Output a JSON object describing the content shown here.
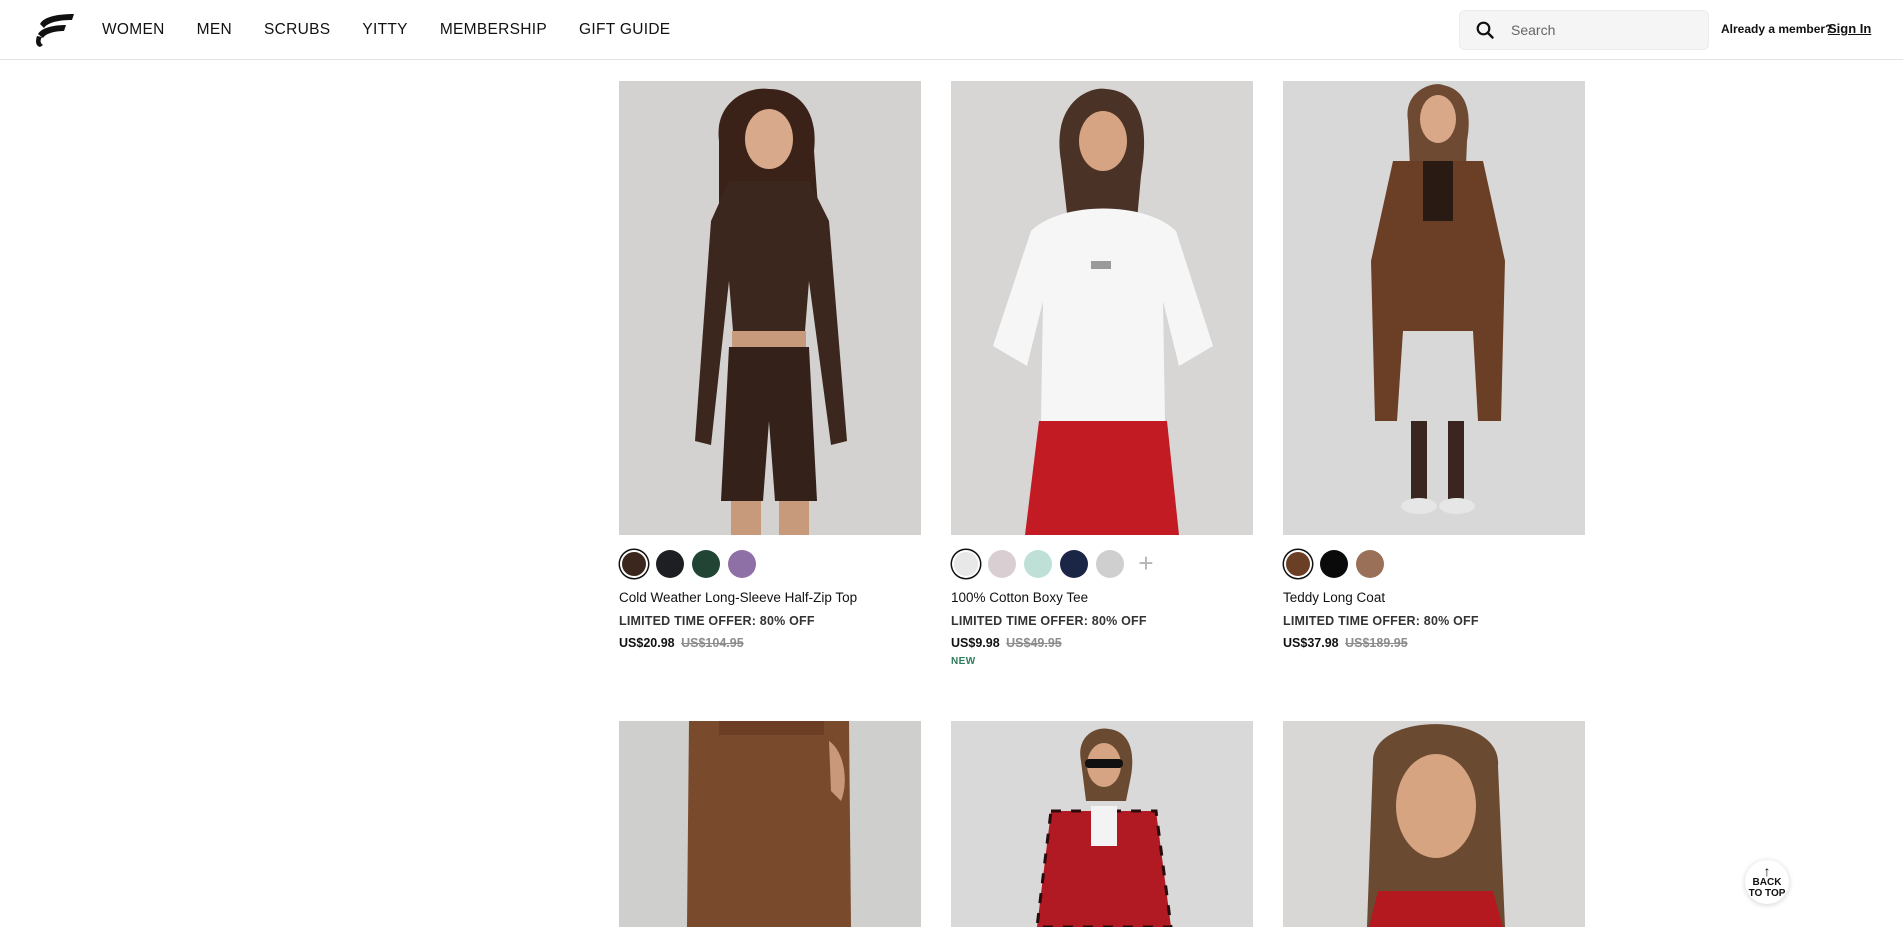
{
  "header": {
    "nav": [
      "WOMEN",
      "MEN",
      "SCRUBS",
      "YITTY",
      "MEMBERSHIP",
      "GIFT GUIDE"
    ],
    "search_placeholder": "Search",
    "member_prompt": "Already a member?",
    "sign_in": "Sign In"
  },
  "products": [
    {
      "name": "Cold Weather Long-Sleeve Half-Zip Top",
      "offer": "LIMITED TIME OFFER: 80% OFF",
      "price": "US$20.98",
      "original_price": "US$104.95",
      "badge": "",
      "swatches": [
        "#3b271d",
        "#1e1f22",
        "#214435",
        "#8e6fa6"
      ]
    },
    {
      "name": "100% Cotton Boxy Tee",
      "offer": "LIMITED TIME OFFER: 80% OFF",
      "price": "US$9.98",
      "original_price": "US$49.95",
      "badge": "NEW",
      "swatches": [
        "#e8e8e8",
        "#d9cfd3",
        "#bfe0d6",
        "#1b2546",
        "#cfcfcf"
      ]
    },
    {
      "name": "Teddy Long Coat",
      "offer": "LIMITED TIME OFFER: 80% OFF",
      "price": "US$37.98",
      "original_price": "US$189.95",
      "badge": "",
      "swatches": [
        "#6b3e26",
        "#0a0a0a",
        "#9a7158"
      ]
    },
    {
      "name": "",
      "offer": "",
      "price": "",
      "original_price": "",
      "badge": "",
      "swatches": []
    },
    {
      "name": "",
      "offer": "",
      "price": "",
      "original_price": "",
      "badge": "",
      "swatches": []
    },
    {
      "name": "",
      "offer": "",
      "price": "",
      "original_price": "",
      "badge": "",
      "swatches": []
    }
  ],
  "back_to_top": "BACK\nTO TOP",
  "icons": {
    "logo": "fabletics-logo",
    "search": "search-icon",
    "more_colors": "plus-icon",
    "back_to_top": "arrow-up-icon"
  }
}
